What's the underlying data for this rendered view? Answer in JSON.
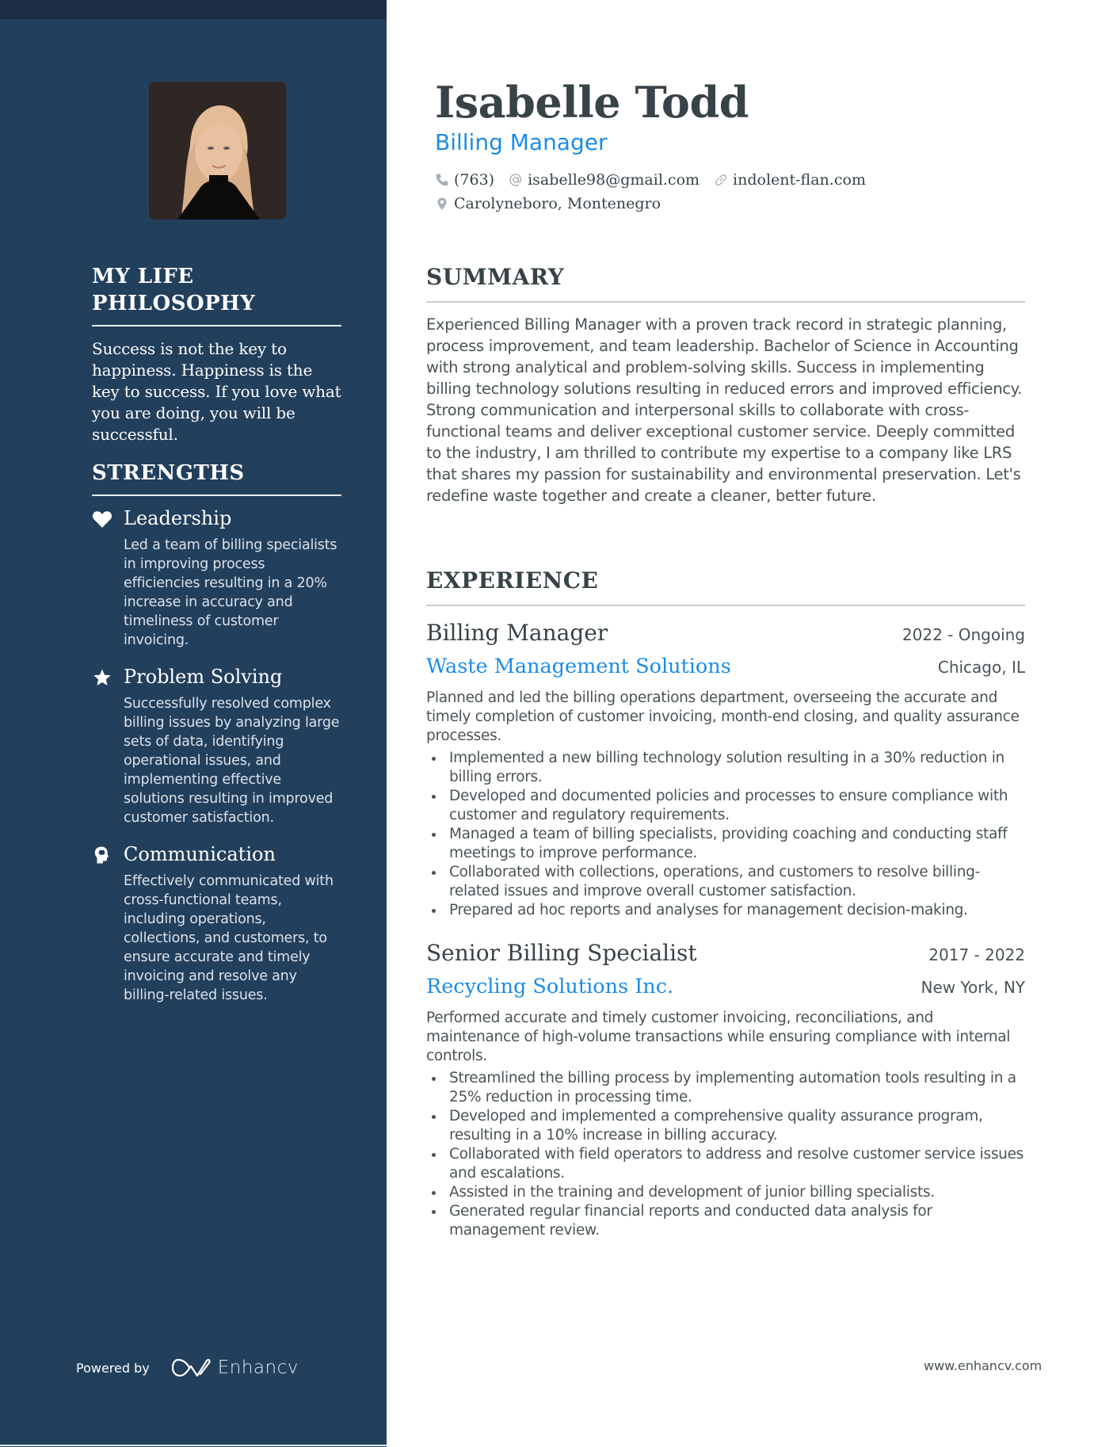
{
  "colors": {
    "sidebar_bg": "#223f5c",
    "sidebar_topband": "#1b2e45",
    "accent": "#1b8ce6",
    "text_dark": "#384347",
    "text_body": "#4a5357"
  },
  "profile": {
    "photo_alt": "Portrait photo of Isabelle Todd",
    "name": "Isabelle Todd",
    "title": "Billing Manager",
    "contacts": {
      "phone": {
        "icon": "phone-icon",
        "value": "(763)"
      },
      "email": {
        "icon": "at-icon",
        "value": "isabelle98@gmail.com"
      },
      "website": {
        "icon": "link-icon",
        "value": "indolent-flan.com"
      },
      "location": {
        "icon": "map-pin-icon",
        "value": "Carolyneboro, Montenegro"
      }
    }
  },
  "sidebar": {
    "philosophy": {
      "title": "MY LIFE PHILOSOPHY",
      "text": "Success is not the key to happiness. Happiness is the key to success. If you love what you are doing, you will be successful."
    },
    "strengths": {
      "title": "STRENGTHS",
      "items": [
        {
          "icon": "heart-icon",
          "name": "Leadership",
          "description": "Led a team of billing specialists in improving process efficiencies resulting in a 20% increase in accuracy and timeliness of customer invoicing."
        },
        {
          "icon": "star-icon",
          "name": "Problem Solving",
          "description": "Successfully resolved complex billing issues by analyzing large sets of data, identifying operational issues, and implementing effective solutions resulting in improved customer satisfaction."
        },
        {
          "icon": "head-brain-icon",
          "name": "Communication",
          "description": "Effectively communicated with cross-functional teams, including operations, collections, and customers, to ensure accurate and timely invoicing and resolve any billing-related issues."
        }
      ]
    },
    "footer": {
      "powered_by": "Powered by",
      "brand": "Enhancv"
    }
  },
  "summary": {
    "title": "SUMMARY",
    "text": "Experienced Billing Manager with a proven track record in strategic planning, process improvement, and team leadership. Bachelor of Science in Accounting with strong analytical and problem-solving skills. Success in implementing billing technology solutions resulting in reduced errors and improved efficiency. Strong communication and interpersonal skills to collaborate with cross-functional teams and deliver exceptional customer service. Deeply committed to the industry, I am thrilled to contribute my expertise to a company like LRS that shares my passion for sustainability and environmental preservation. Let's redefine waste together and create a cleaner, better future."
  },
  "experience": {
    "title": "EXPERIENCE",
    "jobs": [
      {
        "title": "Billing Manager",
        "dates": "2022 - Ongoing",
        "company": "Waste Management Solutions",
        "location": "Chicago, IL",
        "description": "Planned and led the billing operations department, overseeing the accurate and timely completion of customer invoicing, month-end closing, and quality assurance processes.",
        "bullets": [
          "Implemented a new billing technology solution resulting in a 30% reduction in billing errors.",
          "Developed and documented policies and processes to ensure compliance with customer and regulatory requirements.",
          "Managed a team of billing specialists, providing coaching and conducting staff meetings to improve performance.",
          "Collaborated with collections, operations, and customers to resolve billing-related issues and improve overall customer satisfaction.",
          "Prepared ad hoc reports and analyses for management decision-making."
        ]
      },
      {
        "title": "Senior Billing Specialist",
        "dates": "2017 - 2022",
        "company": "Recycling Solutions Inc.",
        "location": "New York, NY",
        "description": "Performed accurate and timely customer invoicing, reconciliations, and maintenance of high-volume transactions while ensuring compliance with internal controls.",
        "bullets": [
          "Streamlined the billing process by implementing automation tools resulting in a 25% reduction in processing time.",
          "Developed and implemented a comprehensive quality assurance program, resulting in a 10% increase in billing accuracy.",
          "Collaborated with field operators to address and resolve customer service issues and escalations.",
          "Assisted in the training and development of junior billing specialists.",
          "Generated regular financial reports and conducted data analysis for management review."
        ]
      }
    ]
  },
  "footer": {
    "website": "www.enhancv.com"
  }
}
